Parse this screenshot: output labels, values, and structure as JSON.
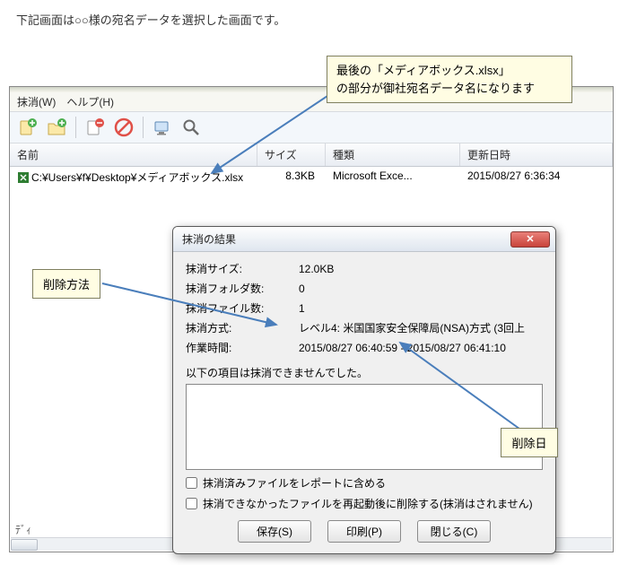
{
  "intro": "下記画面は○○様の宛名データを選択した画面です。",
  "callouts": {
    "top_l1": "最後の「メディアボックス.xlsx」",
    "top_l2": "の部分が御社宛名データ名になります",
    "left": "削除方法",
    "right": "削除日"
  },
  "menu": {
    "erase": "抹消(W)",
    "help": "ヘルプ(H)"
  },
  "columns": {
    "name": "名前",
    "size": "サイズ",
    "type": "種類",
    "updated": "更新日時"
  },
  "rows": [
    {
      "path": "C:¥Users¥f¥Desktop¥メディアボックス.xlsx",
      "size": "8.3KB",
      "type": "Microsoft Exce...",
      "updated": "2015/08/27 6:36:34"
    }
  ],
  "dialog": {
    "title": "抹消の結果",
    "size_label": "抹消サイズ:",
    "size_value": "12.0KB",
    "folders_label": "抹消フォルダ数:",
    "folders_value": "0",
    "files_label": "抹消ファイル数:",
    "files_value": "1",
    "method_label": "抹消方式:",
    "method_value": "レベル4: 米国国家安全保障局(NSA)方式 (3回上",
    "time_label": "作業時間:",
    "time_value": "2015/08/27 06:40:59 - 2015/08/27 06:41:10",
    "failed_head": "以下の項目は抹消できませんでした。",
    "chk1": "抹消済みファイルをレポートに含める",
    "chk2": "抹消できなかったファイルを再起動後に削除する(抹消はされません)",
    "btn_save": "保存(S)",
    "btn_print": "印刷(P)",
    "btn_close": "閉じる(C)"
  },
  "fragment": "ﾃﾞｨ"
}
